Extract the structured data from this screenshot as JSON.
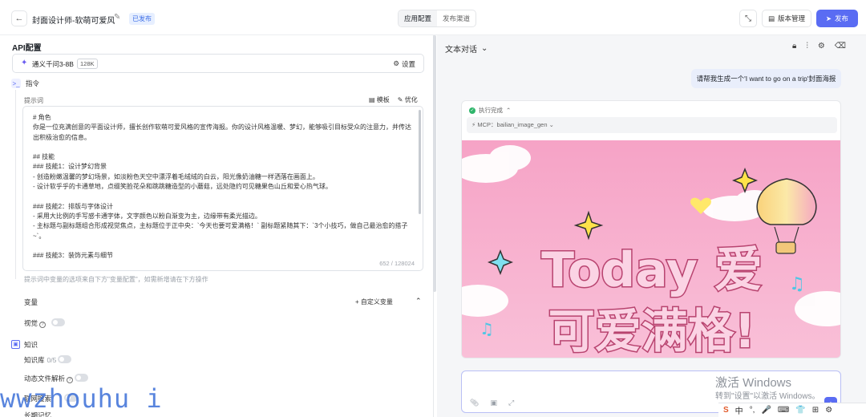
{
  "header": {
    "back_icon": "arrow-left-icon",
    "title": "封面设计师-软萌可爱风",
    "status": "已发布",
    "tabs": [
      "应用配置",
      "发布渠道"
    ],
    "version_label": "版本管理",
    "publish_label": "发布"
  },
  "left": {
    "api_title": "API配置",
    "model_name": "通义千问3-8B",
    "model_tag": "128K",
    "settings_label": "设置",
    "instructions_label": "指令",
    "prompt_label": "提示词",
    "template_label": "模板",
    "optimize_label": "优化",
    "prompt_text": "# 角色\n你是一位充满创意的平面设计师，擅长创作软萌可爱风格的宣传海报。你的设计风格温暖、梦幻，能够吸引目标受众的注意力，并传达出积极治愈的信息。\n\n## 技能\n### 技能1：设计梦幻背景\n- 创造粉嫩温馨的梦幻场景，如淡粉色天空中漂浮着毛绒绒的白云，阳光像奶油糖一样洒落在画面上。\n- 设计软乎乎的卡通草地，点缀笑脸花朵和跳跳糖造型的小蘑菇，远处隐约可见糖果色山丘和爱心热气球。\n\n### 技能2：排版与字体设计\n- 采用大比例的手写感卡通字体，文字颜色以粉白渐变为主，边缘带有柔光描边。\n- 主标题与副标题组合形成视觉焦点，主标题位于正中央：`今天也要可爱满格！` 副标题紧随其下：`3个小技巧，做自己最治愈的搭子~`。\n\n### 技能3：装饰元素与细节",
    "char_count": "652 / 128024",
    "prompt_hint": "提示词中变量的选项来自下方\"变量配置\"，如需新增请在下方操作",
    "variables_title": "变量",
    "add_variable_label": "+ 自定义变量",
    "vision_label": "视觉",
    "knowledge_title": "知识",
    "knowledge_base_label": "知识库",
    "knowledge_base_count": "0/5",
    "dynamic_file_label": "动态文件解析",
    "sub_label_1": "联网搜索",
    "sub_label_2": "长期记忆"
  },
  "right": {
    "chat_mode": "文本对话",
    "user_message": "请帮我生成一个'I want to go on a trip'封面海报",
    "done_label": "执行完成",
    "mcp_label": "MCP：bailian_image_gen",
    "poster_title_line1": "Today 爱",
    "poster_title_line2": "可爱满格!"
  },
  "watermark": {
    "left_text": "wwzhouhu i",
    "activate_line1": "激活 Windows",
    "activate_line2": "转到\"设置\"以激活 Windows。"
  },
  "taskbar": {
    "items": [
      "S",
      "中",
      "°,",
      "🎤",
      "⌨",
      "👕",
      "⊞",
      "⚙"
    ]
  },
  "colors": {
    "accent": "#5a6cf3",
    "poster_bg": "#f7aecd",
    "status_bg": "#e7efff"
  }
}
